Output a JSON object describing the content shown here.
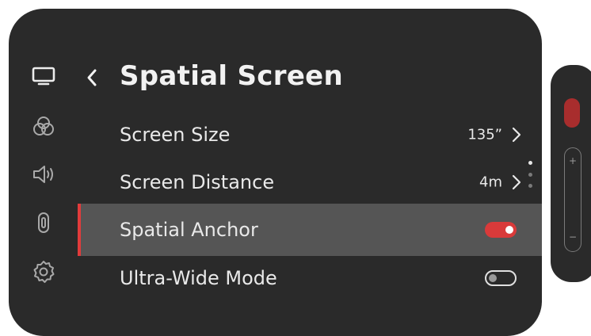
{
  "header": {
    "title": "Spatial Screen"
  },
  "sidebar": {
    "items": [
      {
        "icon": "screen-icon",
        "active": true
      },
      {
        "icon": "color-circles-icon",
        "active": false
      },
      {
        "icon": "speaker-icon",
        "active": false
      },
      {
        "icon": "battery-icon",
        "active": false
      },
      {
        "icon": "gear-icon",
        "active": false
      }
    ]
  },
  "menu": {
    "items": [
      {
        "label": "Screen Size",
        "value": "135”",
        "type": "link"
      },
      {
        "label": "Screen Distance",
        "value": "4m",
        "type": "link"
      },
      {
        "label": "Spatial Anchor",
        "type": "toggle",
        "enabled": true,
        "selected": true
      },
      {
        "label": "Ultra-Wide Mode",
        "type": "toggle",
        "enabled": false
      }
    ]
  },
  "side_widget": {
    "volume_plus": "+",
    "volume_minus": "−"
  },
  "colors": {
    "panel_bg": "#2a2a2a",
    "selected_row_bg": "#555555",
    "accent": "#e23b3b",
    "text": "#e9e9e9"
  }
}
